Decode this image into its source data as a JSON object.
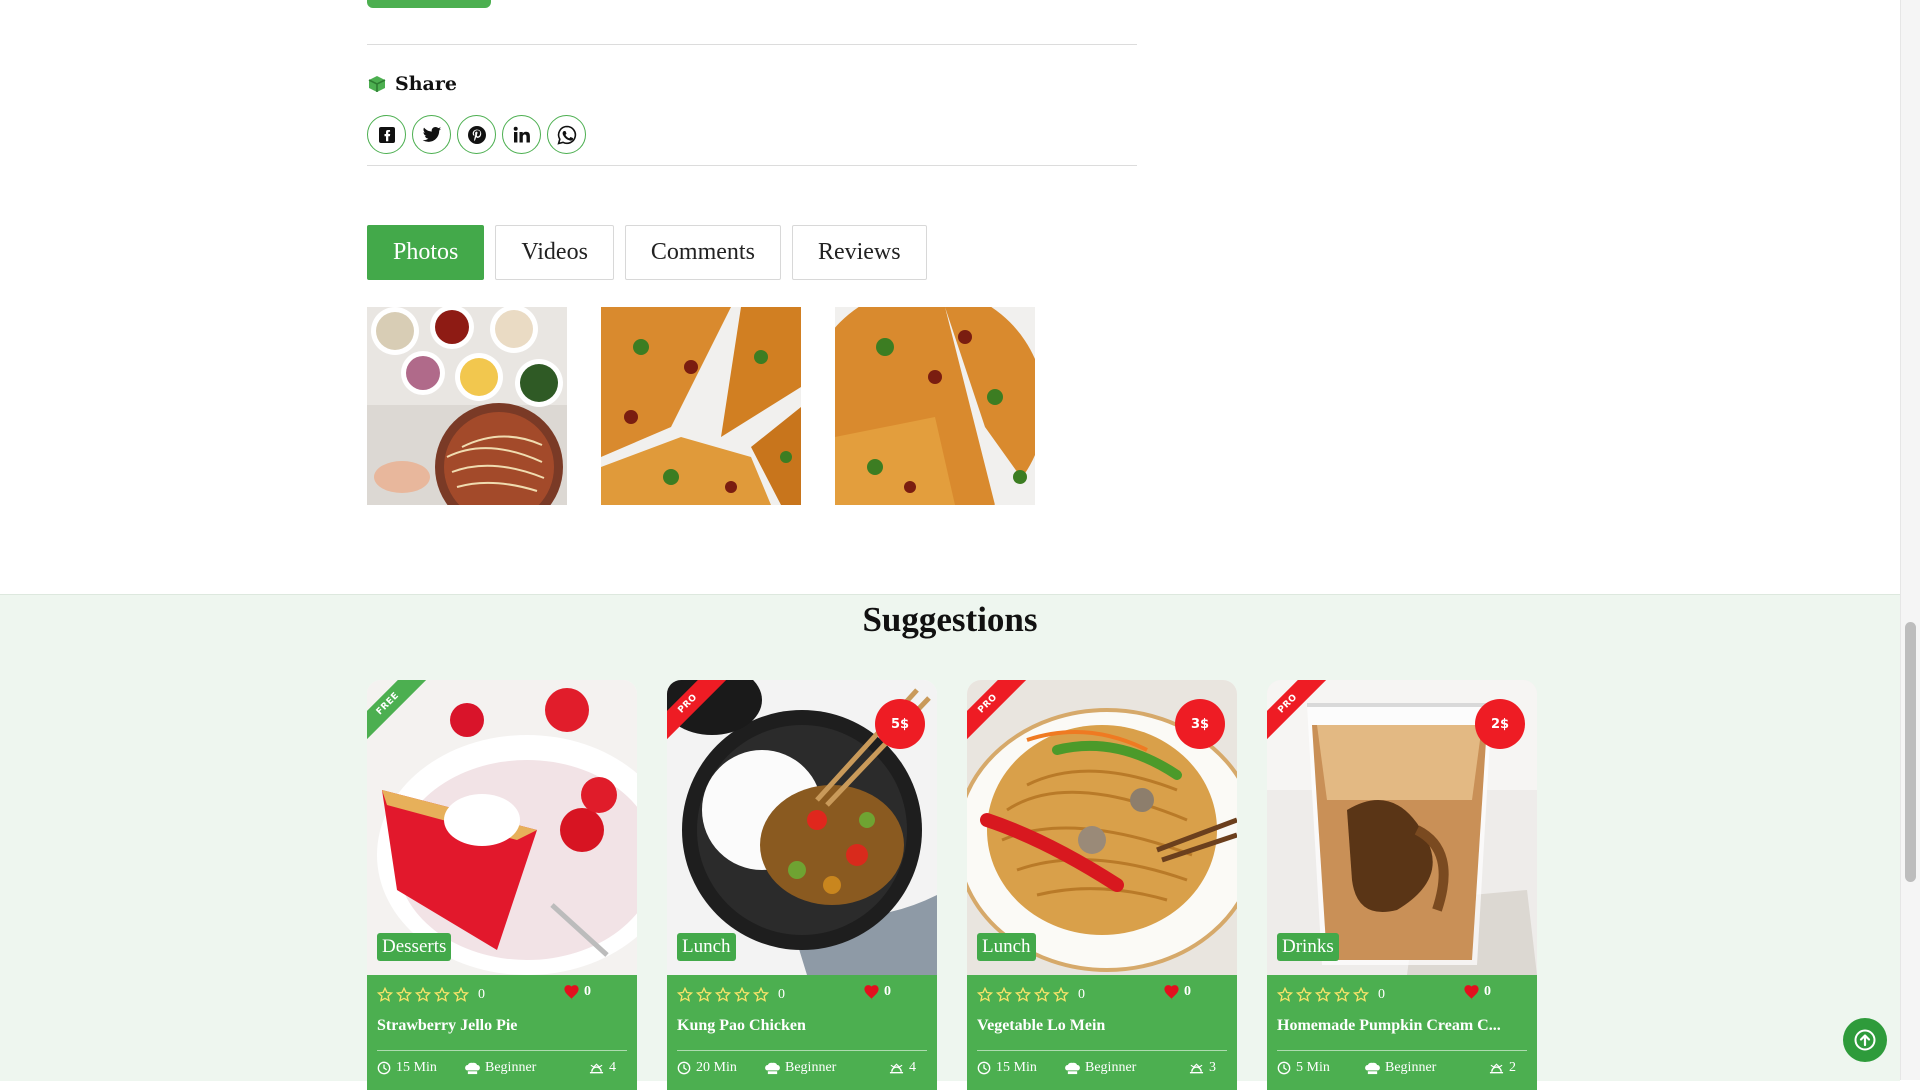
{
  "share": {
    "title": "Share",
    "icon": "box-icon"
  },
  "social_buttons": [
    {
      "name": "facebook-icon"
    },
    {
      "name": "twitter-icon"
    },
    {
      "name": "pinterest-icon"
    },
    {
      "name": "linkedin-icon"
    },
    {
      "name": "whatsapp-icon"
    }
  ],
  "tabs": [
    {
      "label": "Photos",
      "active": true
    },
    {
      "label": "Videos",
      "active": false
    },
    {
      "label": "Comments",
      "active": false
    },
    {
      "label": "Reviews",
      "active": false
    }
  ],
  "suggestions": {
    "title": "Suggestions",
    "cards": [
      {
        "badge": "FREE",
        "badge_color": "#4caf50",
        "price": "",
        "category": "Desserts",
        "rating": "0",
        "likes": "0",
        "title": "Strawberry Jello Pie",
        "time": "15 Min",
        "level": "Beginner",
        "servings": "4"
      },
      {
        "badge": "PRO",
        "badge_color": "#ee1c24",
        "price": "5$",
        "category": "Lunch",
        "rating": "0",
        "likes": "0",
        "title": "Kung Pao Chicken",
        "time": "20 Min",
        "level": "Beginner",
        "servings": "4"
      },
      {
        "badge": "PRO",
        "badge_color": "#ee1c24",
        "price": "3$",
        "category": "Lunch",
        "rating": "0",
        "likes": "0",
        "title": "Vegetable Lo Mein",
        "time": "15 Min",
        "level": "Beginner",
        "servings": "3"
      },
      {
        "badge": "PRO",
        "badge_color": "#ee1c24",
        "price": "2$",
        "category": "Drinks",
        "rating": "0",
        "likes": "0",
        "title": "Homemade Pumpkin Cream C...",
        "time": "5 Min",
        "level": "Beginner",
        "servings": "2"
      }
    ]
  },
  "colors": {
    "accent": "#4caf50",
    "price_red": "#ee1c24",
    "section_bg": "#eef6ef"
  }
}
